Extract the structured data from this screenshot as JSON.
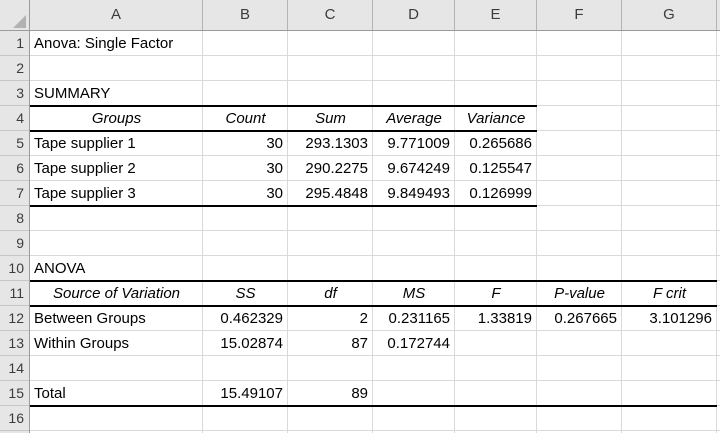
{
  "columns": [
    "A",
    "B",
    "C",
    "D",
    "E",
    "F",
    "G"
  ],
  "rows": [
    "1",
    "2",
    "3",
    "4",
    "5",
    "6",
    "7",
    "8",
    "9",
    "10",
    "11",
    "12",
    "13",
    "14",
    "15",
    "16"
  ],
  "cells": {
    "title": "Anova: Single Factor",
    "summary_label": "SUMMARY",
    "anova_label": "ANOVA"
  },
  "summary_table": {
    "headers": [
      "Groups",
      "Count",
      "Sum",
      "Average",
      "Variance"
    ],
    "rows": [
      {
        "group": "Tape supplier 1",
        "count": "30",
        "sum": "293.1303",
        "average": "9.771009",
        "variance": "0.265686"
      },
      {
        "group": "Tape supplier 2",
        "count": "30",
        "sum": "290.2275",
        "average": "9.674249",
        "variance": "0.125547"
      },
      {
        "group": "Tape supplier 3",
        "count": "30",
        "sum": "295.4848",
        "average": "9.849493",
        "variance": "0.126999"
      }
    ]
  },
  "anova_table": {
    "headers": [
      "Source of Variation",
      "SS",
      "df",
      "MS",
      "F",
      "P-value",
      "F crit"
    ],
    "rows": [
      {
        "source": "Between Groups",
        "ss": "0.462329",
        "df": "2",
        "ms": "0.231165",
        "f": "1.33819",
        "p_value": "0.267665",
        "f_crit": "3.101296"
      },
      {
        "source": "Within Groups",
        "ss": "15.02874",
        "df": "87",
        "ms": "0.172744"
      },
      {
        "source": "Total",
        "ss": "15.49107",
        "df": "89"
      }
    ]
  },
  "colors": {
    "header_fill": "#e6e6e6",
    "header_border": "#9b9b9b",
    "gridline": "#d9d9d9",
    "table_border": "#000000",
    "cell_text": "#000000"
  }
}
